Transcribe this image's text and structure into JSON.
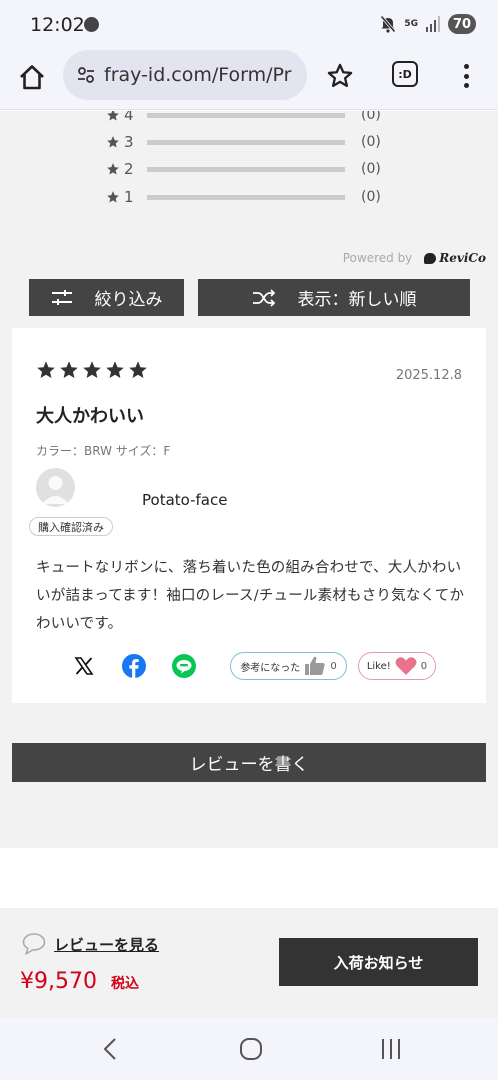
{
  "status_bar": {
    "time": "12:02",
    "network": "5G",
    "battery": "70",
    "icons": [
      "line-notification-icon",
      "mute-icon",
      "signal-icon",
      "battery-icon"
    ]
  },
  "browser": {
    "url": "fray-id.com/Form/Pr",
    "tab_label": ":D",
    "icons": [
      "home-icon",
      "site-settings-icon",
      "bookmark-star-icon",
      "tab-switcher-icon",
      "overflow-menu-icon"
    ]
  },
  "rating_summary": [
    {
      "stars": "4",
      "count": "(0)"
    },
    {
      "stars": "3",
      "count": "(0)"
    },
    {
      "stars": "2",
      "count": "(0)"
    },
    {
      "stars": "1",
      "count": "(0)"
    }
  ],
  "powered_by": {
    "label": "Powered by",
    "brand": "ReviCo"
  },
  "controls": {
    "filter_label": "絞り込み",
    "sort_label": "表示：新しい順"
  },
  "review": {
    "rating": 5,
    "date": "2025.12.8",
    "title": "大人かわいい",
    "meta": "カラー：BRW サイズ：F",
    "reviewer": "Potato-face",
    "badge": "購入確認済み",
    "body": "キュートなリボンに、落ち着いた色の組み合わせで、大人かわいいが詰まってます！袖口のレース/チュール素材もさり気なくてかわいいです。",
    "helpful_label": "参考になった",
    "helpful_count": "0",
    "like_label": "Like!",
    "like_count": "0",
    "share_icons": [
      "x-icon",
      "facebook-icon",
      "line-icon"
    ]
  },
  "write_review_label": "レビューを書く",
  "action_bar": {
    "see_reviews": "レビューを見る",
    "price": "¥9,570",
    "tax": "税込",
    "notify_label": "入荷お知らせ"
  },
  "colors": {
    "price_red": "#d0021b",
    "dark_button": "#444444",
    "page_bg": "#f2f2f2",
    "facebook_blue": "#1877f2",
    "line_green": "#06c755",
    "helpful_border": "#7ac1d6",
    "like_border": "#e89aa3",
    "heart_pink": "#e8738a"
  },
  "nav": {
    "icons": [
      "back-icon",
      "home-circle-icon",
      "recent-apps-icon"
    ]
  }
}
